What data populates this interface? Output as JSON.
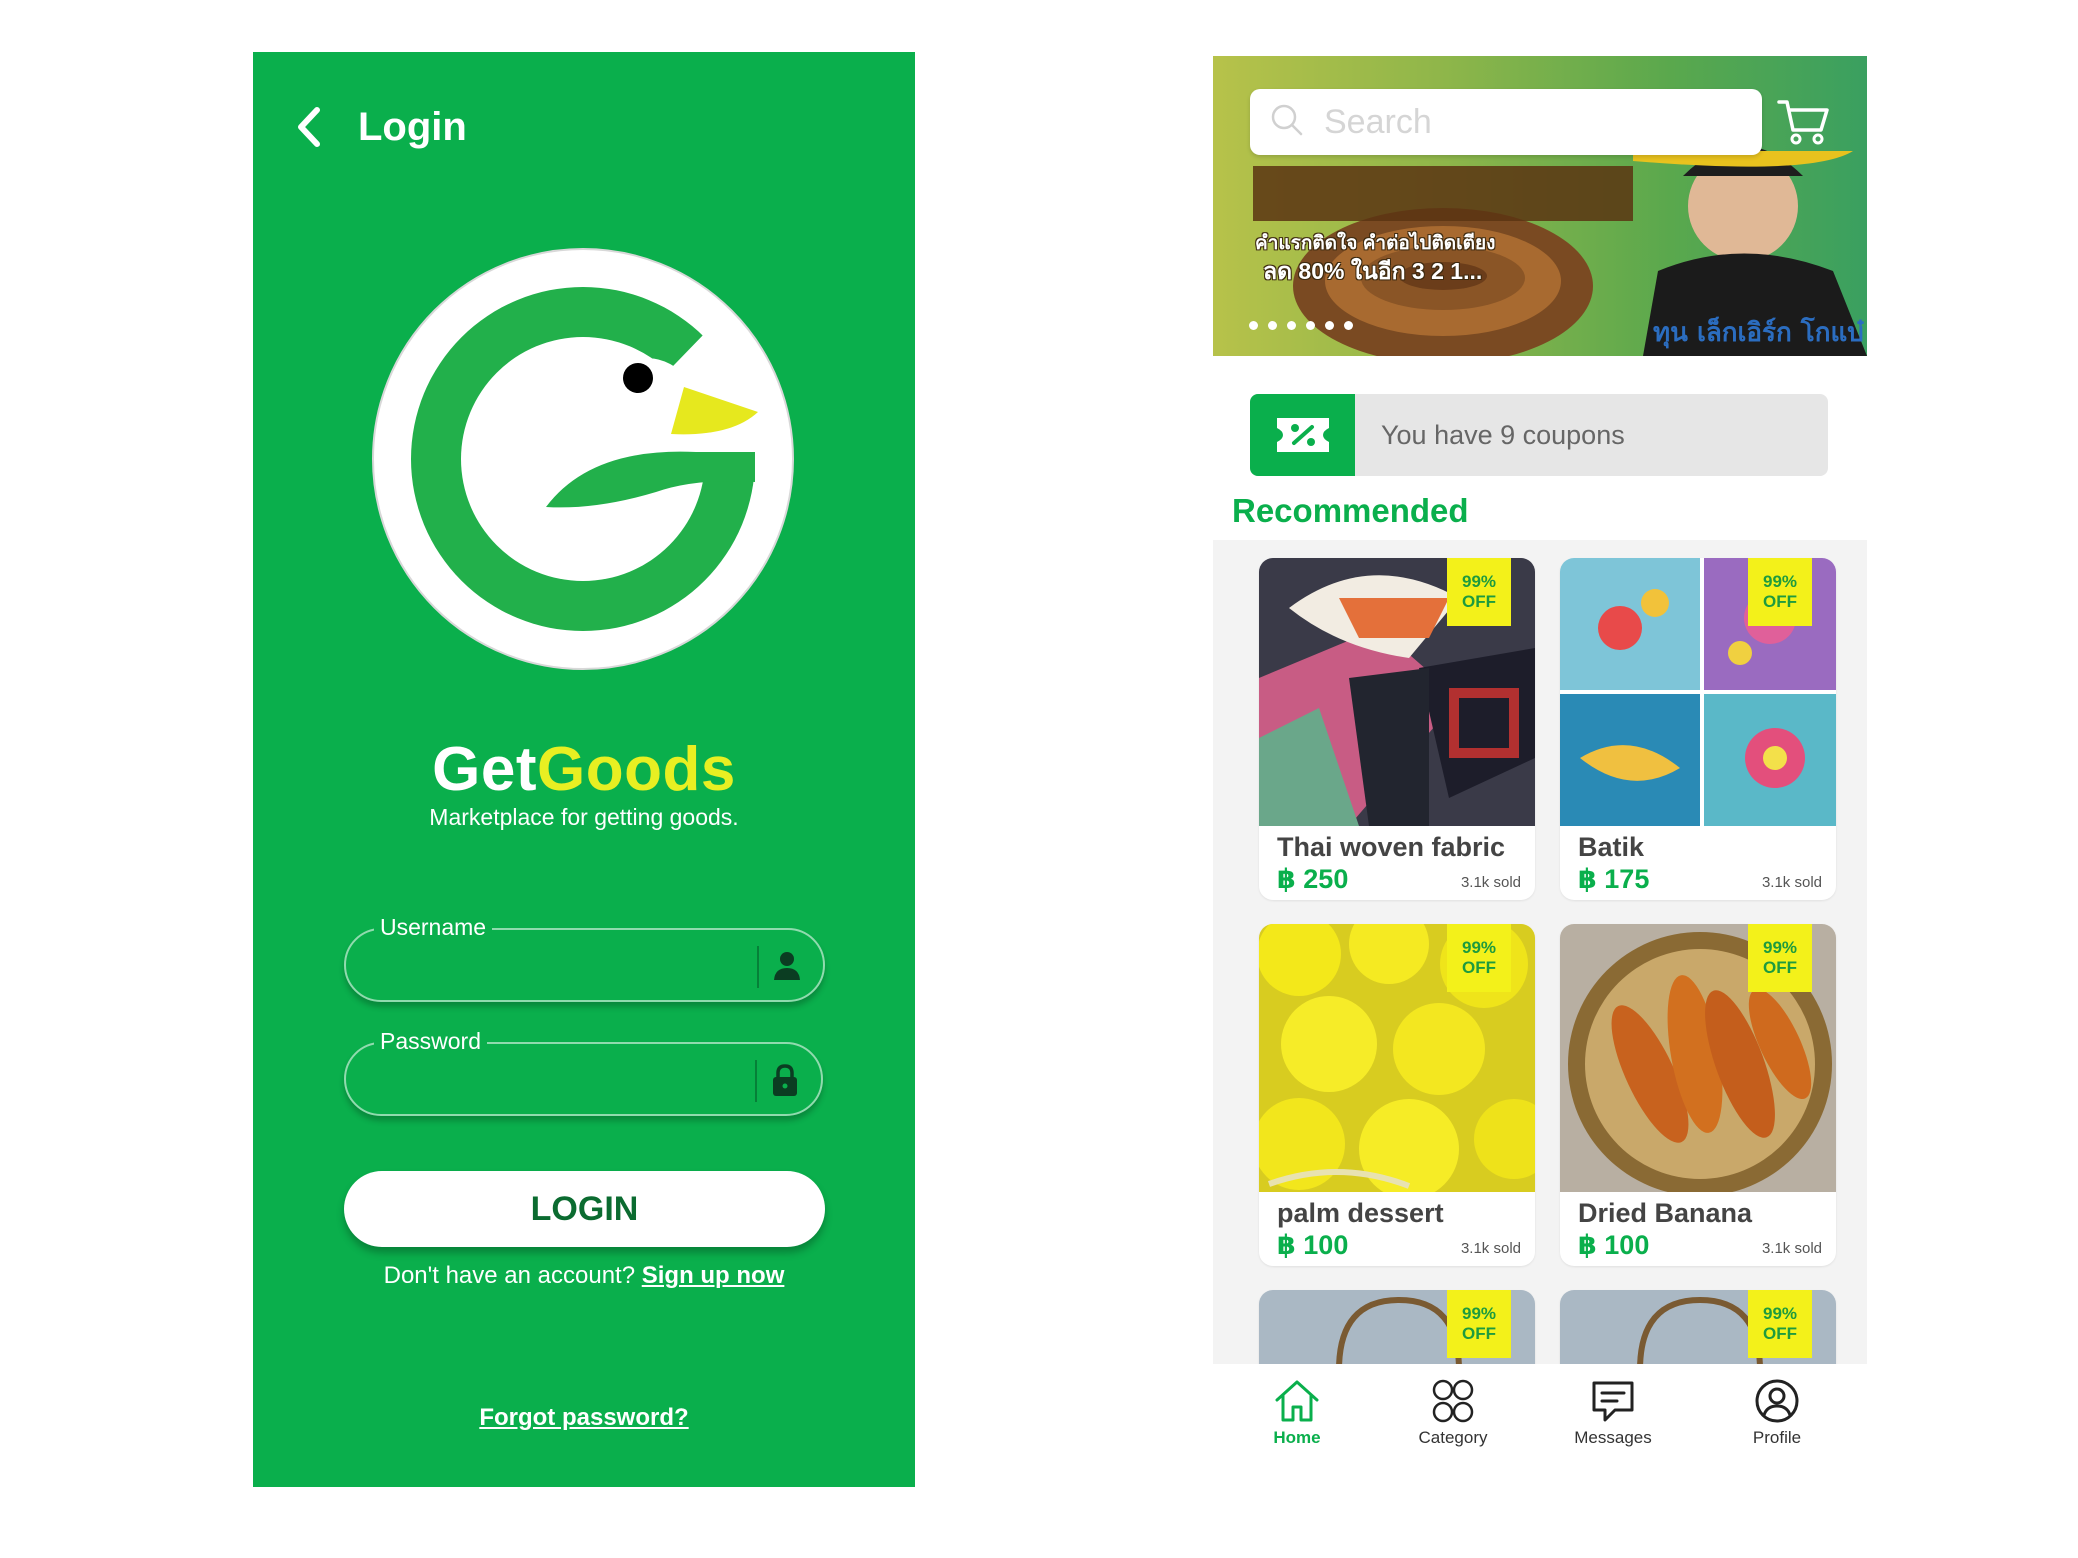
{
  "colors": {
    "brand_green": "#0aaf4c",
    "accent_yellow": "#e8ef22",
    "badge_yellow": "#f3f11a"
  },
  "login": {
    "title": "Login",
    "brand_part1": "Get",
    "brand_part2": "Goods",
    "tagline": "Marketplace for getting goods.",
    "username_label": "Username",
    "username_value": "",
    "password_label": "Password",
    "password_value": "",
    "login_button": "LOGIN",
    "signup_prompt": "Don't have an account?",
    "signup_link": "Sign up now",
    "forgot_link": "Forgot password?",
    "icons": {
      "back": "chevron-left-icon",
      "user": "user-icon",
      "lock": "lock-icon"
    }
  },
  "home": {
    "search_placeholder": "Search",
    "banner": {
      "line1": "คำแรกติดใจ คำต่อไปติดเตียง",
      "line2": "ลด 80% ในอีก 3 2 1...",
      "slide_count": 6
    },
    "coupon_text": "You have 9 coupons",
    "section_title": "Recommended",
    "products": [
      {
        "name": "Thai woven fabric",
        "price": "฿ 250",
        "sold": "3.1k sold",
        "badge_line1": "99%",
        "badge_line2": "OFF"
      },
      {
        "name": "Batik",
        "price": "฿ 175",
        "sold": "3.1k sold",
        "badge_line1": "99%",
        "badge_line2": "OFF"
      },
      {
        "name": "palm dessert",
        "price": "฿ 100",
        "sold": "3.1k sold",
        "badge_line1": "99%",
        "badge_line2": "OFF"
      },
      {
        "name": "Dried Banana",
        "price": "฿ 100",
        "sold": "3.1k sold",
        "badge_line1": "99%",
        "badge_line2": "OFF"
      },
      {
        "badge_line1": "99%",
        "badge_line2": "OFF"
      },
      {
        "badge_line1": "99%",
        "badge_line2": "OFF"
      }
    ],
    "nav": [
      {
        "label": "Home",
        "icon": "home-icon",
        "active": true
      },
      {
        "label": "Category",
        "icon": "category-icon",
        "active": false
      },
      {
        "label": "Messages",
        "icon": "messages-icon",
        "active": false
      },
      {
        "label": "Profile",
        "icon": "profile-icon",
        "active": false
      }
    ]
  }
}
